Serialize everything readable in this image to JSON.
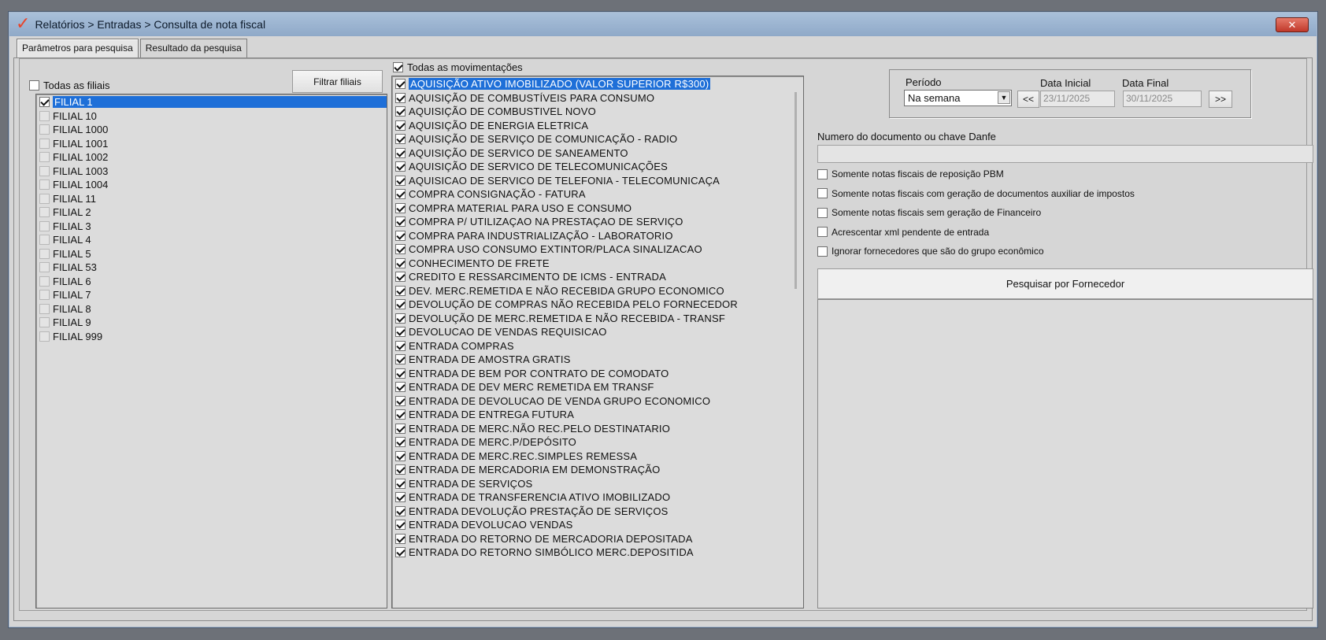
{
  "window": {
    "title": "Relatórios > Entradas > Consulta de nota fiscal",
    "close_label": "✕"
  },
  "tabs": [
    {
      "label": "Parâmetros para pesquisa",
      "active": true
    },
    {
      "label": "Resultado da pesquisa",
      "active": false
    }
  ],
  "branches": {
    "all_label": "Todas as filiais",
    "all_checked": false,
    "filter_button": "Filtrar filiais",
    "items": [
      {
        "label": "FILIAL 1",
        "checked": true,
        "selected": true
      },
      {
        "label": "FILIAL 10",
        "checked": false
      },
      {
        "label": "FILIAL 1000",
        "checked": false
      },
      {
        "label": "FILIAL 1001",
        "checked": false
      },
      {
        "label": "FILIAL 1002",
        "checked": false
      },
      {
        "label": "FILIAL 1003",
        "checked": false
      },
      {
        "label": "FILIAL 1004",
        "checked": false
      },
      {
        "label": "FILIAL 11",
        "checked": false
      },
      {
        "label": "FILIAL 2",
        "checked": false
      },
      {
        "label": "FILIAL 3",
        "checked": false
      },
      {
        "label": "FILIAL 4",
        "checked": false
      },
      {
        "label": "FILIAL 5",
        "checked": false
      },
      {
        "label": "FILIAL 53",
        "checked": false
      },
      {
        "label": "FILIAL 6",
        "checked": false
      },
      {
        "label": "FILIAL 7",
        "checked": false
      },
      {
        "label": "FILIAL 8",
        "checked": false
      },
      {
        "label": "FILIAL 9",
        "checked": false
      },
      {
        "label": "FILIAL 999",
        "checked": false
      }
    ]
  },
  "movements": {
    "all_label": "Todas as movimentações",
    "all_checked": true,
    "items": [
      {
        "label": "AQUISIÇÃO ATIVO IMOBILIZADO (VALOR SUPERIOR R$300)",
        "checked": true,
        "selected": true
      },
      {
        "label": "AQUISIÇÃO DE COMBUSTÍVEIS PARA CONSUMO",
        "checked": true
      },
      {
        "label": "AQUISIÇÃO DE COMBUSTIVEL NOVO",
        "checked": true
      },
      {
        "label": "AQUISIÇÃO DE ENERGIA ELETRICA",
        "checked": true
      },
      {
        "label": "AQUISIÇÃO DE SERVIÇO DE COMUNICAÇÃO - RADIO",
        "checked": true
      },
      {
        "label": "AQUISIÇÃO DE SERVICO DE SANEAMENTO",
        "checked": true
      },
      {
        "label": "AQUISIÇÃO DE SERVICO DE TELECOMUNICAÇÕES",
        "checked": true
      },
      {
        "label": "AQUISICAO DE SERVICO DE TELEFONIA - TELECOMUNICAÇA",
        "checked": true
      },
      {
        "label": "COMPRA CONSIGNAÇÃO - FATURA",
        "checked": true
      },
      {
        "label": "COMPRA MATERIAL PARA USO E CONSUMO",
        "checked": true
      },
      {
        "label": "COMPRA P/ UTILIZAÇAO NA PRESTAÇAO DE SERVIÇO",
        "checked": true
      },
      {
        "label": "COMPRA PARA INDUSTRIALIZAÇÃO - LABORATORIO",
        "checked": true
      },
      {
        "label": "COMPRA USO CONSUMO EXTINTOR/PLACA SINALIZACAO",
        "checked": true
      },
      {
        "label": "CONHECIMENTO DE FRETE",
        "checked": true
      },
      {
        "label": "CREDITO E RESSARCIMENTO DE ICMS - ENTRADA",
        "checked": true
      },
      {
        "label": "DEV. MERC.REMETIDA E NÃO RECEBIDA GRUPO ECONOMICO",
        "checked": true
      },
      {
        "label": "DEVOLUÇÃO DE COMPRAS NÃO RECEBIDA PELO FORNECEDOR",
        "checked": true
      },
      {
        "label": "DEVOLUÇÃO DE MERC.REMETIDA E NÃO RECEBIDA - TRANSF",
        "checked": true
      },
      {
        "label": "DEVOLUCAO DE VENDAS REQUISICAO",
        "checked": true
      },
      {
        "label": "ENTRADA COMPRAS",
        "checked": true
      },
      {
        "label": "ENTRADA DE AMOSTRA GRATIS",
        "checked": true
      },
      {
        "label": "ENTRADA DE BEM POR CONTRATO DE COMODATO",
        "checked": true
      },
      {
        "label": "ENTRADA DE DEV MERC REMETIDA EM TRANSF",
        "checked": true
      },
      {
        "label": "ENTRADA DE DEVOLUCAO DE VENDA GRUPO ECONOMICO",
        "checked": true
      },
      {
        "label": "ENTRADA DE ENTREGA FUTURA",
        "checked": true
      },
      {
        "label": "ENTRADA DE MERC.NÃO REC.PELO DESTINATARIO",
        "checked": true
      },
      {
        "label": "ENTRADA DE MERC.P/DEPÓSITO",
        "checked": true
      },
      {
        "label": "ENTRADA DE MERC.REC.SIMPLES REMESSA",
        "checked": true
      },
      {
        "label": "ENTRADA DE MERCADORIA EM DEMONSTRAÇÃO",
        "checked": true
      },
      {
        "label": "ENTRADA DE SERVIÇOS",
        "checked": true
      },
      {
        "label": "ENTRADA DE TRANSFERENCIA ATIVO IMOBILIZADO",
        "checked": true
      },
      {
        "label": "ENTRADA DEVOLUÇÃO PRESTAÇÃO DE SERVIÇOS",
        "checked": true
      },
      {
        "label": "ENTRADA DEVOLUCAO VENDAS",
        "checked": true
      },
      {
        "label": "ENTRADA DO RETORNO DE MERCADORIA DEPOSITADA",
        "checked": true
      },
      {
        "label": "ENTRADA DO RETORNO SIMBÓLICO MERC.DEPOSITIDA",
        "checked": true
      }
    ]
  },
  "period": {
    "label": "Período",
    "selected": "Na semana",
    "prev_label": "<<",
    "next_label": ">>",
    "start_label": "Data Inicial",
    "start_value": "23/11/2025",
    "end_label": "Data Final",
    "end_value": "30/11/2025"
  },
  "document": {
    "label": "Numero do documento ou chave Danfe",
    "value": ""
  },
  "options": [
    {
      "label": "Somente notas fiscais de reposição PBM",
      "checked": false
    },
    {
      "label": "Somente notas fiscais com geração de documentos auxiliar de impostos",
      "checked": false
    },
    {
      "label": "Somente notas fiscais sem geração de Financeiro",
      "checked": false
    },
    {
      "label": "Acrescentar xml pendente de entrada",
      "checked": false
    },
    {
      "label": "Ignorar fornecedores que são do grupo econômico",
      "checked": false
    }
  ],
  "supplier_button": "Pesquisar por Fornecedor"
}
